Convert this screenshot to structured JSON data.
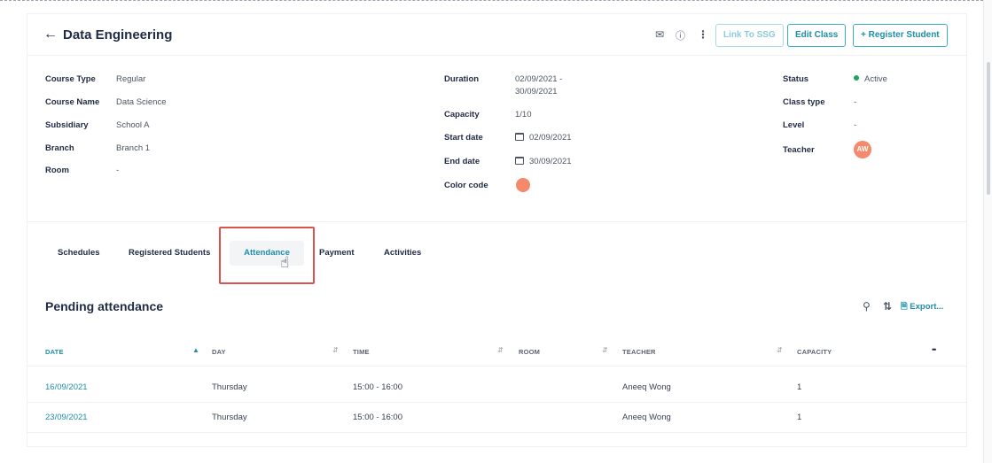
{
  "header": {
    "title": "Data Engineering",
    "back_icon": "arrow-left-icon",
    "buttons": {
      "link_ssg": "Link To SSG",
      "edit_class": "Edit Class",
      "register_student": "+ Register Student"
    }
  },
  "details": {
    "left": [
      {
        "label": "Course Type",
        "value": "Regular"
      },
      {
        "label": "Course Name",
        "value": "Data Science"
      },
      {
        "label": "Subsidiary",
        "value": "School A"
      },
      {
        "label": "Branch",
        "value": "Branch 1"
      },
      {
        "label": "Room",
        "value": "-"
      }
    ],
    "middle": {
      "duration_label": "Duration",
      "duration_line1": "02/09/2021 -",
      "duration_line2": "30/09/2021",
      "capacity_label": "Capacity",
      "capacity_value": "1/10",
      "start_label": "Start date",
      "start_value": "02/09/2021",
      "end_label": "End date",
      "end_value": "30/09/2021",
      "color_label": "Color code",
      "color_value": "#f4896b"
    },
    "right": {
      "status_label": "Status",
      "status_value": "Active",
      "class_type_label": "Class type",
      "class_type_value": "-",
      "level_label": "Level",
      "level_value": "-",
      "teacher_label": "Teacher",
      "teacher_initials": "AW"
    }
  },
  "tabs": [
    "Schedules",
    "Registered Students",
    "Attendance",
    "Payment",
    "Activities"
  ],
  "active_tab": "Attendance",
  "section": {
    "title": "Pending attendance",
    "export_label": "Export..."
  },
  "table": {
    "columns": [
      "DATE",
      "DAY",
      "TIME",
      "ROOM",
      "TEACHER",
      "CAPACITY"
    ],
    "rows": [
      {
        "date": "16/09/2021",
        "day": "Thursday",
        "time": "15:00 - 16:00",
        "room": "",
        "teacher": "Aneeq Wong",
        "capacity": "1"
      },
      {
        "date": "23/09/2021",
        "day": "Thursday",
        "time": "15:00 - 16:00",
        "room": "",
        "teacher": "Aneeq Wong",
        "capacity": "1"
      }
    ]
  },
  "colors": {
    "accent": "#1f8ea8",
    "status_active": "#1fa35d",
    "highlight": "#d9534f"
  }
}
